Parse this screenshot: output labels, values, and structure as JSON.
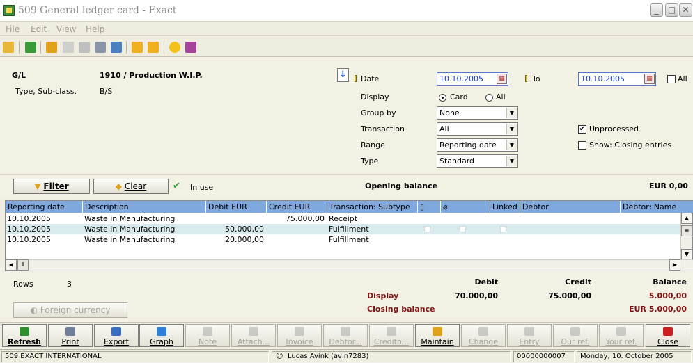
{
  "window": {
    "title": "509 General ledger card - Exact",
    "minimize": "_",
    "maximize": "□",
    "close": "✕"
  },
  "menu": {
    "items": [
      "File",
      "Edit",
      "View",
      "Help"
    ]
  },
  "header": {
    "gl_label": "G/L",
    "gl_value": "1910 / Production W.I.P.",
    "type_label": "Type, Sub-class.",
    "type_value": "B/S",
    "date_label": "Date",
    "date_from": "10.10.2005",
    "to_label": "To",
    "date_to": "10.10.2005",
    "all_label": "All",
    "display_label": "Display",
    "display_card": "Card",
    "display_all": "All",
    "groupby_label": "Group by",
    "groupby_value": "None",
    "transaction_label": "Transaction",
    "transaction_value": "All",
    "range_label": "Range",
    "range_value": "Reporting date",
    "type2_label": "Type",
    "type2_value": "Standard",
    "unprocessed_label": "Unprocessed",
    "closing_label": "Show: Closing entries"
  },
  "filter": {
    "filter_label": "Filter",
    "clear_label": "Clear",
    "in_use": "In use",
    "opening_label": "Opening balance",
    "opening_value": "EUR 0,00"
  },
  "grid": {
    "columns": [
      "Reporting date",
      "Description",
      "Debit EUR",
      "Credit EUR",
      "Transaction: Subtype",
      "",
      "",
      "Linked",
      "Debtor",
      "Debtor: Name"
    ],
    "rows": [
      {
        "date": "10.10.2005",
        "desc": "Waste in Manufacturing",
        "debit": "",
        "credit": "75.000,00",
        "subtype": "Receipt"
      },
      {
        "date": "10.10.2005",
        "desc": "Waste in Manufacturing",
        "debit": "50.000,00",
        "credit": "",
        "subtype": "Fulfillment"
      },
      {
        "date": "10.10.2005",
        "desc": "Waste in Manufacturing",
        "debit": "20.000,00",
        "credit": "",
        "subtype": "Fulfillment"
      }
    ]
  },
  "totals": {
    "rows_label": "Rows",
    "rows_value": "3",
    "debit_head": "Debit",
    "credit_head": "Credit",
    "balance_head": "Balance",
    "display_label": "Display",
    "display_debit": "70.000,00",
    "display_credit": "75.000,00",
    "display_balance": "5.000,00",
    "closing_label": "Closing balance",
    "closing_balance": "EUR 5.000,00",
    "foreign_label": "Foreign currency"
  },
  "buttons": [
    {
      "label": "Refresh",
      "color": "#2f8f2f"
    },
    {
      "label": "Print",
      "color": "#6f7f9a"
    },
    {
      "label": "Export",
      "color": "#3a6fc0"
    },
    {
      "label": "Graph",
      "color": "#2c7fd6"
    },
    {
      "label": "Note",
      "color": "#9a9a9a"
    },
    {
      "label": "Attach...",
      "color": "#9a9a9a"
    },
    {
      "label": "Invoice",
      "color": "#9a9a9a"
    },
    {
      "label": "Debtor...",
      "color": "#9a9a9a"
    },
    {
      "label": "Credito...",
      "color": "#9a9a9a"
    },
    {
      "label": "Maintain",
      "color": "#e0a21a"
    },
    {
      "label": "Change",
      "color": "#9a9a9a"
    },
    {
      "label": "Entry",
      "color": "#9a9a9a"
    },
    {
      "label": "Our ref.",
      "color": "#9a9a9a"
    },
    {
      "label": "Your ref.",
      "color": "#9a9a9a"
    },
    {
      "label": "Close",
      "color": "#cc1f1f"
    }
  ],
  "status": {
    "company": "509 EXACT INTERNATIONAL",
    "user": "Lucas Avink (avin7283)",
    "number": "00000000007",
    "date": "Monday, 10. October 2005"
  },
  "colors": {
    "grid_header": "#7fa8df",
    "selected_row": "#d9ebec",
    "accent_maroon": "#7d1212"
  }
}
